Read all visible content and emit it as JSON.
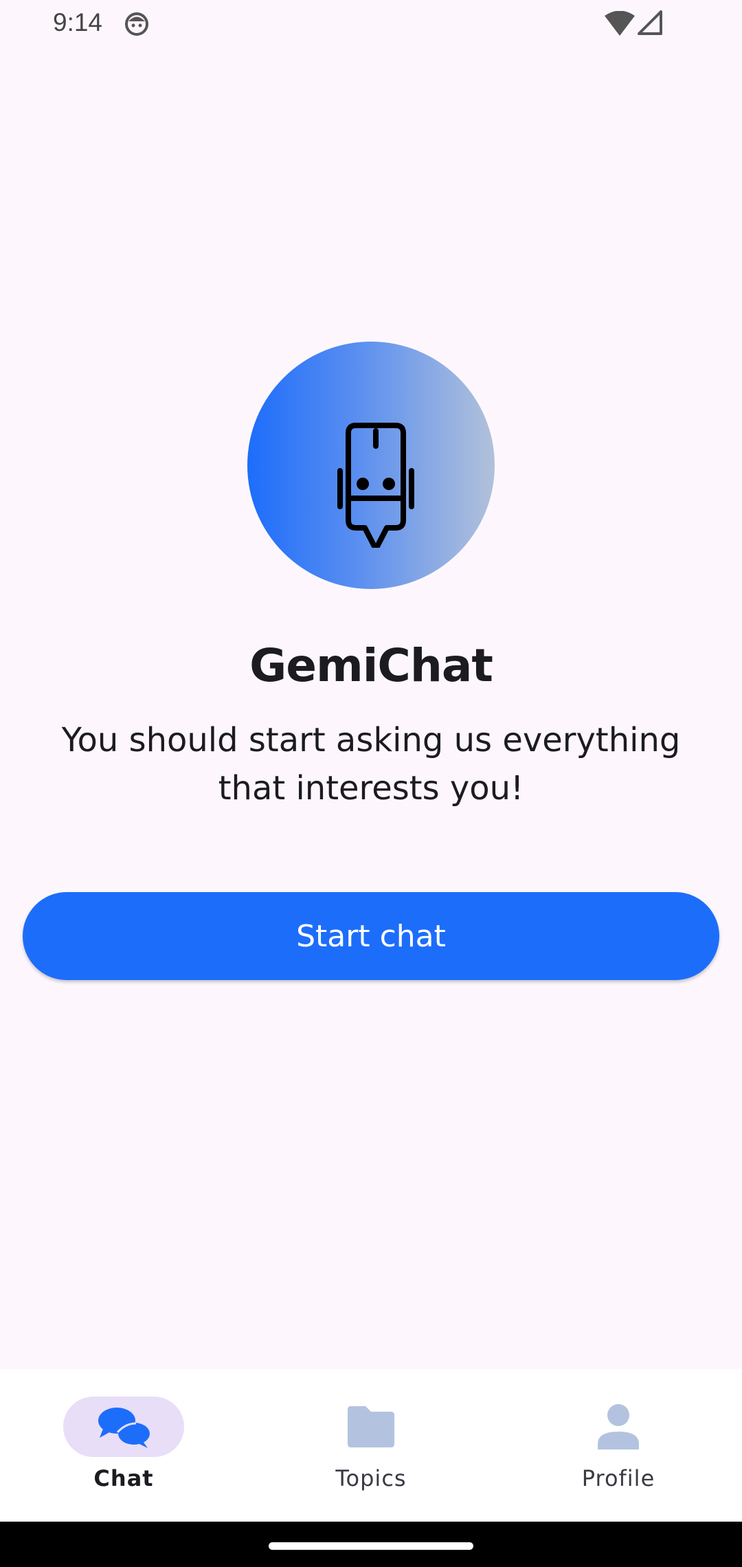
{
  "status_bar": {
    "time": "9:14",
    "icons": [
      "face-icon",
      "wifi-icon",
      "cellular-signal-icon"
    ]
  },
  "hero": {
    "icon": "robot-chat-icon",
    "title": "GemiChat",
    "subtitle": "You should start asking us everything that interests you!",
    "colors": {
      "gradient_start": "#1d6dfb",
      "gradient_end": "#b2c1da"
    }
  },
  "actions": {
    "start_chat_label": "Start chat",
    "accent_color": "#1d6dfb"
  },
  "bottom_nav": {
    "items": [
      {
        "label": "Chat",
        "icon": "chat-bubbles-icon",
        "active": true
      },
      {
        "label": "Topics",
        "icon": "folder-icon",
        "active": false
      },
      {
        "label": "Profile",
        "icon": "person-icon",
        "active": false
      }
    ],
    "active_pill_color": "#e8def8",
    "inactive_icon_color": "#b3c3df"
  }
}
